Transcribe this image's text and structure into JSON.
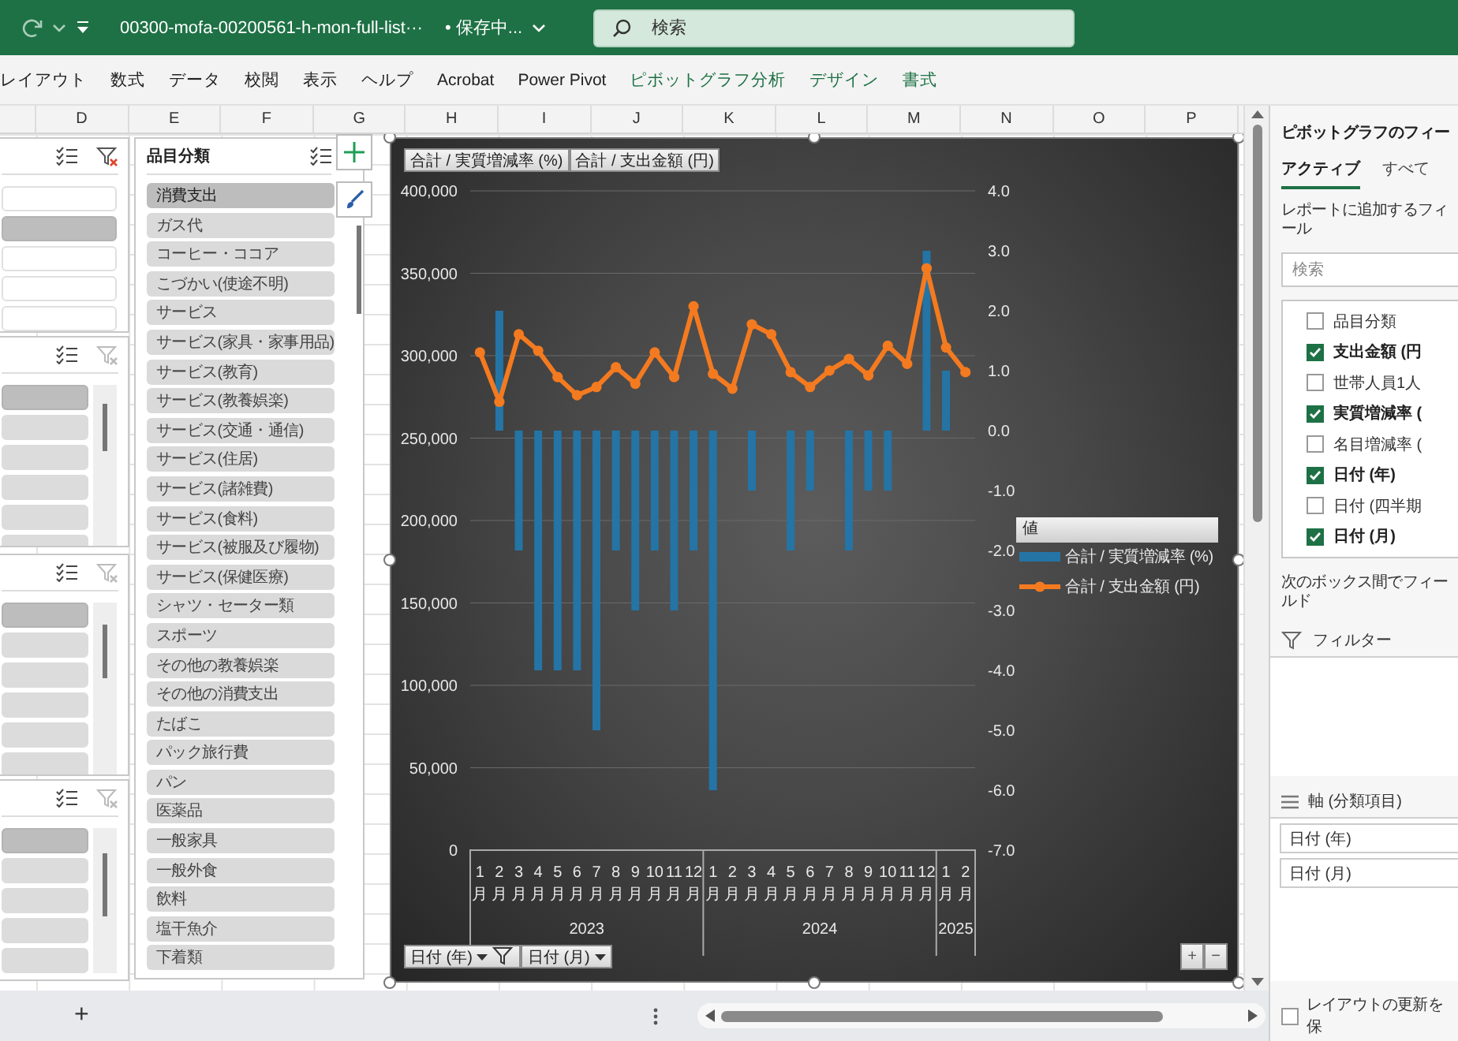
{
  "title_bar": {
    "file_name": "00300-mofa-00200561-h-mon-full-list···",
    "save_status": "• 保存中...",
    "search": {
      "placeholder": "検索"
    }
  },
  "ribbon_tabs": [
    {
      "label": "レイアウト",
      "kind": "standard"
    },
    {
      "label": "数式",
      "kind": "standard"
    },
    {
      "label": "データ",
      "kind": "standard"
    },
    {
      "label": "校閲",
      "kind": "standard"
    },
    {
      "label": "表示",
      "kind": "standard"
    },
    {
      "label": "ヘルプ",
      "kind": "standard"
    },
    {
      "label": "Acrobat",
      "kind": "standard"
    },
    {
      "label": "Power Pivot",
      "kind": "standard"
    },
    {
      "label": "ピボットグラフ分析",
      "kind": "contextual"
    },
    {
      "label": "デザイン",
      "kind": "contextual"
    },
    {
      "label": "書式",
      "kind": "contextual"
    }
  ],
  "column_headers": [
    "D",
    "E",
    "F",
    "G",
    "H",
    "I",
    "J",
    "K",
    "L",
    "M",
    "N",
    "O",
    "P"
  ],
  "left_slicers": [
    {
      "kind": "plain",
      "filter_active": true,
      "items": [
        {
          "selected": false
        },
        {
          "selected": true
        },
        {
          "selected": false
        },
        {
          "selected": false
        },
        {
          "selected": false
        }
      ]
    },
    {
      "kind": "scroll",
      "filter_active": false,
      "items": [
        {
          "selected": true
        },
        {
          "selected": false
        },
        {
          "selected": false
        },
        {
          "selected": false
        },
        {
          "selected": false
        },
        {
          "selected": false
        }
      ]
    },
    {
      "kind": "scroll",
      "filter_active": false,
      "items": [
        {
          "selected": true
        },
        {
          "selected": false
        },
        {
          "selected": false
        },
        {
          "selected": false
        },
        {
          "selected": false
        },
        {
          "selected": false
        }
      ]
    },
    {
      "kind": "scroll",
      "filter_active": false,
      "items": [
        {
          "selected": true
        },
        {
          "selected": false
        },
        {
          "selected": false
        },
        {
          "selected": false
        },
        {
          "selected": false
        }
      ]
    }
  ],
  "slicer": {
    "title": "品目分類",
    "items": [
      {
        "label": "消費支出",
        "selected": true
      },
      {
        "label": "ガス代",
        "selected": false
      },
      {
        "label": "コーヒー・ココア",
        "selected": false
      },
      {
        "label": "こづかい(使途不明)",
        "selected": false
      },
      {
        "label": "サービス",
        "selected": false
      },
      {
        "label": "サービス(家具・家事用品)",
        "selected": false
      },
      {
        "label": "サービス(教育)",
        "selected": false
      },
      {
        "label": "サービス(教養娯楽)",
        "selected": false
      },
      {
        "label": "サービス(交通・通信)",
        "selected": false
      },
      {
        "label": "サービス(住居)",
        "selected": false
      },
      {
        "label": "サービス(諸雑費)",
        "selected": false
      },
      {
        "label": "サービス(食料)",
        "selected": false
      },
      {
        "label": "サービス(被服及び履物)",
        "selected": false
      },
      {
        "label": "サービス(保健医療)",
        "selected": false
      },
      {
        "label": "シャツ・セーター類",
        "selected": false
      },
      {
        "label": "スポーツ",
        "selected": false
      },
      {
        "label": "その他の教養娯楽",
        "selected": false
      },
      {
        "label": "その他の消費支出",
        "selected": false
      },
      {
        "label": "たばこ",
        "selected": false
      },
      {
        "label": "パック旅行費",
        "selected": false
      },
      {
        "label": "パン",
        "selected": false
      },
      {
        "label": "医薬品",
        "selected": false
      },
      {
        "label": "一般家具",
        "selected": false
      },
      {
        "label": "一般外食",
        "selected": false
      },
      {
        "label": "飲料",
        "selected": false
      },
      {
        "label": "塩干魚介",
        "selected": false
      },
      {
        "label": "下着類",
        "selected": false
      }
    ]
  },
  "chart": {
    "selected": true,
    "value_buttons": [
      "合計 / 実質増減率 (%)",
      "合計 / 支出金額 (円)"
    ],
    "axis_buttons": [
      {
        "label": "日付 (年)",
        "filtered": true
      },
      {
        "label": "日付 (月)",
        "filtered": false
      }
    ],
    "zoom_buttons": [
      "+",
      "−"
    ],
    "legend_title": "値",
    "chart_data": {
      "type": "bar",
      "grid": true,
      "legend": "right",
      "categories": [
        "1月",
        "2月",
        "3月",
        "4月",
        "5月",
        "6月",
        "7月",
        "8月",
        "9月",
        "10月",
        "11月",
        "12月",
        "1月",
        "2月",
        "3月",
        "4月",
        "5月",
        "6月",
        "7月",
        "8月",
        "9月",
        "10月",
        "11月",
        "12月",
        "1月",
        "2月"
      ],
      "annotations": [
        "2023",
        "2024",
        "2025"
      ],
      "ylim": [
        0,
        400000
      ],
      "yticks": [
        {
          "value": 0,
          "label": "0"
        },
        {
          "value": 50000,
          "label": "50,000"
        },
        {
          "value": 100000,
          "label": "100,000"
        },
        {
          "value": 150000,
          "label": "150,000"
        },
        {
          "value": 200000,
          "label": "200,000"
        },
        {
          "value": 250000,
          "label": "250,000"
        },
        {
          "value": 300000,
          "label": "300,000"
        },
        {
          "value": 350000,
          "label": "350,000"
        },
        {
          "value": 400000,
          "label": "400,000"
        }
      ],
      "y2lim": [
        -7,
        4
      ],
      "y2ticks": [
        {
          "value": 4,
          "label": "4.0"
        },
        {
          "value": 3,
          "label": "3.0"
        },
        {
          "value": 2,
          "label": "2.0"
        },
        {
          "value": 1,
          "label": "1.0"
        },
        {
          "value": 0,
          "label": "0.0"
        },
        {
          "value": -1,
          "label": "-1.0"
        },
        {
          "value": -2,
          "label": "-2.0"
        },
        {
          "value": -3,
          "label": "-3.0"
        },
        {
          "value": -4,
          "label": "-4.0"
        },
        {
          "value": -5,
          "label": "-5.0"
        },
        {
          "value": -6,
          "label": "-6.0"
        },
        {
          "value": -7,
          "label": "-7.0"
        }
      ],
      "series": [
        {
          "name": "合計 / 実質増減率 (%)",
          "type": "bar",
          "axis": "y2",
          "color": "#2474a6",
          "values": [
            null,
            2,
            -2,
            -4,
            -4,
            -4,
            -5,
            -2,
            -3,
            -2,
            -3,
            -2,
            -6,
            null,
            -1,
            null,
            -2,
            -1,
            null,
            -2,
            -1,
            -1,
            null,
            3,
            1,
            null
          ]
        },
        {
          "name": "合計 / 支出金額 (円)",
          "type": "line",
          "marker": "circle",
          "color": "#f47a20",
          "values": [
            302000,
            272000,
            313000,
            303000,
            287000,
            276000,
            281000,
            293000,
            283000,
            302000,
            287000,
            330000,
            289000,
            280000,
            319000,
            313000,
            290000,
            281000,
            291000,
            298000,
            288000,
            306000,
            295000,
            353000,
            305000,
            290000
          ]
        }
      ]
    }
  },
  "sheet_bar": {
    "add_label": "+"
  },
  "field_pane": {
    "title": "ピボットグラフのフィー",
    "tabs": [
      {
        "label": "アクティブ",
        "selected": true
      },
      {
        "label": "すべて",
        "selected": false
      }
    ],
    "instruction": "レポートに追加するフィール",
    "search": {
      "placeholder": "検索"
    },
    "fields": [
      {
        "label": "品目分類",
        "checked": false
      },
      {
        "label": "支出金額 (円",
        "checked": true
      },
      {
        "label": "世帯人員1人",
        "checked": false
      },
      {
        "label": "実質増減率 (",
        "checked": true
      },
      {
        "label": "名目増減率 (",
        "checked": false
      },
      {
        "label": "日付 (年)",
        "checked": true
      },
      {
        "label": "日付 (四半期",
        "checked": false
      },
      {
        "label": "日付 (月)",
        "checked": true
      }
    ],
    "areas_instruction": "次のボックス間でフィールド",
    "areas": [
      {
        "kind": "filter",
        "label": "フィルター"
      },
      {
        "kind": "axis",
        "label": "軸 (分類項目)",
        "items": [
          "日付 (年)",
          "日付 (月)"
        ]
      }
    ],
    "defer_update": {
      "label": "レイアウトの更新を保",
      "checked": false
    }
  }
}
